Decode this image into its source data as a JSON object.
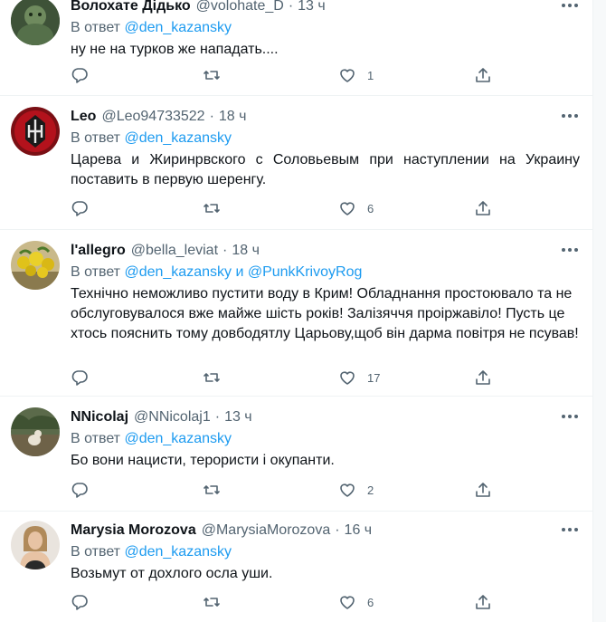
{
  "tweets": [
    {
      "name": "Волохате Дідько",
      "handle": "@volohate_D",
      "time": "13 ч",
      "reply_prefix": "В ответ",
      "mentions": [
        "@den_kazansky"
      ],
      "text": "ну не на турков же нападать....",
      "likes": "1",
      "retweets": "",
      "replies": ""
    },
    {
      "name": "Leo",
      "handle": "@Leo94733522",
      "time": "18 ч",
      "reply_prefix": "В ответ",
      "mentions": [
        "@den_kazansky"
      ],
      "text": "Царева и Жиринрвского с Соловьевым при наступлении на Украину поставить в первую шеренгу.",
      "likes": "6",
      "retweets": "",
      "replies": ""
    },
    {
      "name": "l'allegro",
      "handle": "@bella_leviat",
      "time": "18 ч",
      "reply_prefix": "В ответ",
      "mentions": [
        "@den_kazansky",
        "@PunkKrivoyRog"
      ],
      "mention_joiner": "и",
      "text": "Технічно неможливо пустити воду в Крим! Обладнання простоювало та не обслуговувалося вже майже шість років! Залізяччя проіржавіло! Пусть це хтось пояснить тому довбодятлу Царьову,щоб він дарма повітря не псував!",
      "likes": "17",
      "retweets": "",
      "replies": ""
    },
    {
      "name": "NNicolaj",
      "handle": "@NNicolaj1",
      "time": "13 ч",
      "reply_prefix": "В ответ",
      "mentions": [
        "@den_kazansky"
      ],
      "text": "Бо вони нацисти, терористи і окупанти.",
      "likes": "2",
      "retweets": "",
      "replies": ""
    },
    {
      "name": "Marysia Morozova",
      "handle": "@MarysiaMorozova",
      "time": "16 ч",
      "reply_prefix": "В ответ",
      "mentions": [
        "@den_kazansky"
      ],
      "text": "Возьмут от дохлого осла уши.",
      "likes": "6",
      "retweets": "",
      "replies": ""
    }
  ],
  "separator": "·",
  "icons": {
    "reply": "reply-icon",
    "retweet": "retweet-icon",
    "like": "like-icon",
    "share": "share-icon",
    "more": "more-icon"
  },
  "colors": {
    "text": "#0f1419",
    "secondary": "#536471",
    "link": "#1d9bf0",
    "border": "#eff3f4"
  }
}
